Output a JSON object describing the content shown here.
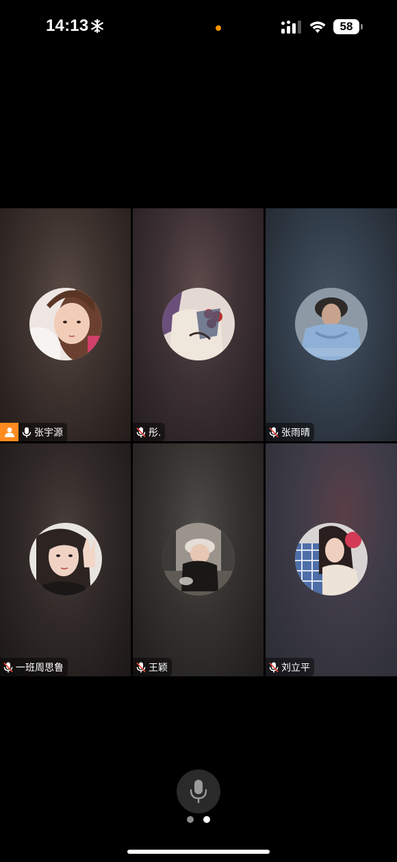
{
  "status_bar": {
    "time": "14:13",
    "battery": "58",
    "recording_indicator_color": "#ff9500",
    "icons": [
      "snowflake-icon",
      "signal-icon",
      "wifi-icon",
      "battery-icon"
    ]
  },
  "participants": [
    {
      "name": "张宇源",
      "mic": "on",
      "host": true,
      "avatar": "girl-child"
    },
    {
      "name": "彤.",
      "mic": "muted",
      "host": false,
      "avatar": "flowers"
    },
    {
      "name": "张雨晴",
      "mic": "muted",
      "host": false,
      "avatar": "figure-blue"
    },
    {
      "name": "一班周思鲁",
      "mic": "muted",
      "host": false,
      "avatar": "peace-sign-girl"
    },
    {
      "name": "王颖",
      "mic": "muted",
      "host": false,
      "avatar": "girl-cap"
    },
    {
      "name": "刘立平",
      "mic": "muted",
      "host": false,
      "avatar": "girl-plaid"
    }
  ],
  "controls": {
    "mic_button_icon": "microphone-icon",
    "pagination": {
      "count": 2,
      "current": 2
    }
  },
  "colors": {
    "host_badge": "#ff8a1f",
    "muted_slash": "#e0453a"
  }
}
